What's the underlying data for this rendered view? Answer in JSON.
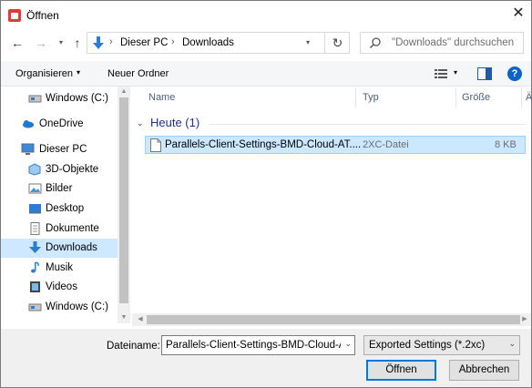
{
  "window": {
    "title": "Öffnen"
  },
  "nav": {
    "crumbs": [
      "Dieser PC",
      "Downloads"
    ],
    "search_placeholder": "\"Downloads\" durchsuchen"
  },
  "toolbar": {
    "organize": "Organisieren",
    "new_folder": "Neuer Ordner"
  },
  "sidebar": {
    "items": [
      {
        "label": "Windows (C:)",
        "icon": "drive-icon"
      },
      {
        "label": "OneDrive",
        "icon": "cloud-icon"
      },
      {
        "label": "Dieser PC",
        "icon": "computer-icon"
      },
      {
        "label": "3D-Objekte",
        "icon": "cube-icon"
      },
      {
        "label": "Bilder",
        "icon": "pictures-icon"
      },
      {
        "label": "Desktop",
        "icon": "desktop-icon"
      },
      {
        "label": "Dokumente",
        "icon": "documents-icon"
      },
      {
        "label": "Downloads",
        "icon": "download-icon",
        "selected": true
      },
      {
        "label": "Musik",
        "icon": "music-icon"
      },
      {
        "label": "Videos",
        "icon": "videos-icon"
      },
      {
        "label": "Windows (C:)",
        "icon": "drive-icon"
      }
    ]
  },
  "columns": {
    "name": "Name",
    "type": "Typ",
    "size": "Größe",
    "more": "Ä"
  },
  "group": {
    "label": "Heute (1)"
  },
  "file": {
    "name": "Parallels-Client-Settings-BMD-Cloud-AT....",
    "type": "2XC-Datei",
    "size": "8 KB"
  },
  "bottom": {
    "filename_label": "Dateiname:",
    "filename_value": "Parallels-Client-Settings-BMD-Cloud-AT",
    "filetype_value": "Exported Settings (*.2xc)",
    "open": "Öffnen",
    "cancel": "Abbrechen"
  },
  "colors": {
    "accent": "#0078d7",
    "selection": "#cce8ff"
  }
}
